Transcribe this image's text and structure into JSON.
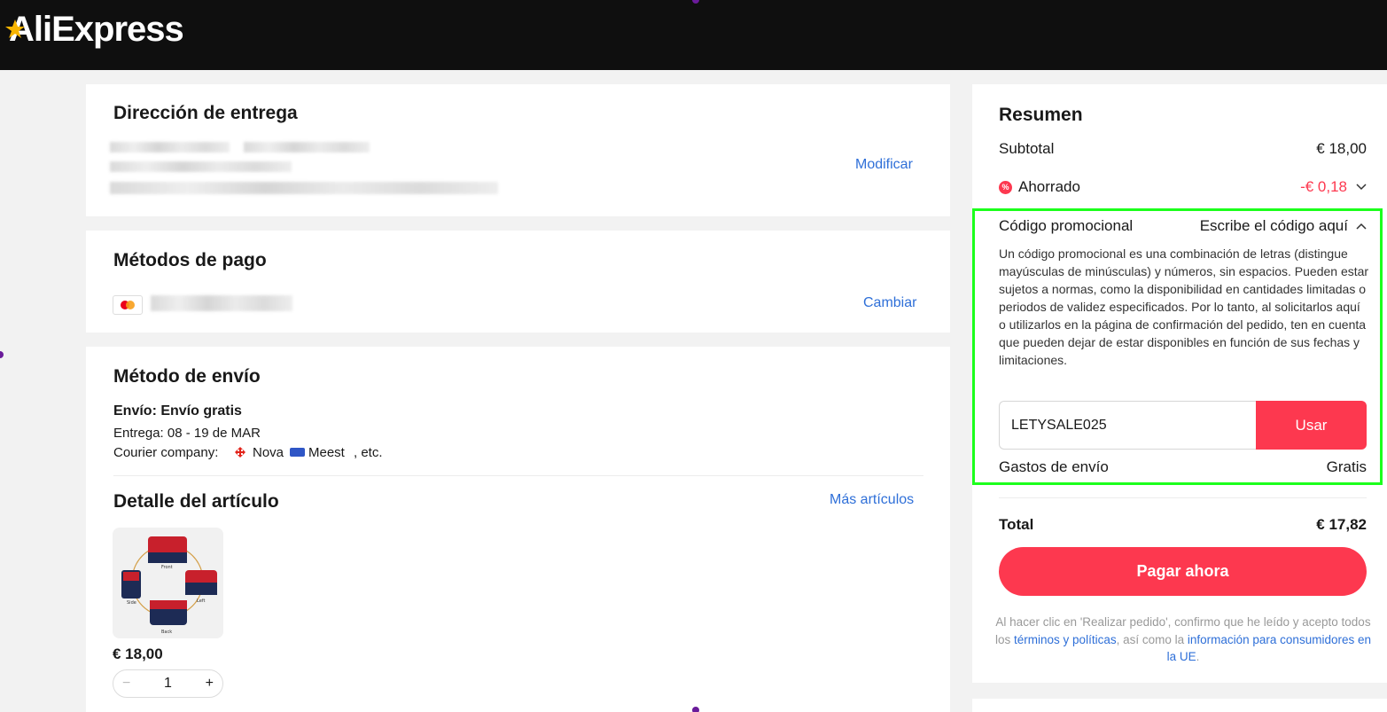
{
  "header": {
    "logo_text": "AliExpress"
  },
  "address": {
    "title": "Dirección de entrega",
    "action": "Modificar"
  },
  "payment": {
    "title": "Métodos de pago",
    "action": "Cambiar"
  },
  "shipping": {
    "title": "Método de envío",
    "method": "Envío: Envío gratis",
    "delivery": "Entrega: 08 - 19 de MAR",
    "courier_label": "Courier company:",
    "courier_1": "Nova",
    "courier_2": "Meest",
    "courier_suffix": ", etc."
  },
  "items": {
    "title": "Detalle del artículo",
    "more_link": "Más artículos",
    "price": "€ 18,00",
    "quantity": "1",
    "minus": "−",
    "plus": "+",
    "image_labels": {
      "front": "Front",
      "side": "Side",
      "left": "Left",
      "back": "Back"
    }
  },
  "summary": {
    "title": "Resumen",
    "subtotal_label": "Subtotal",
    "subtotal_value": "€ 18,00",
    "saved_label": "Ahorrado",
    "saved_value": "-€ 0,18",
    "promo_label": "Código promocional",
    "promo_action": "Escribe el código aquí",
    "promo_description": "Un código promocional es una combinación de letras (distingue mayúsculas de minúsculas) y números, sin espacios. Pueden estar sujetos a normas, como la disponibilidad en cantidades limitadas o periodos de validez especificados. Por lo tanto, al solicitarlos aquí o utilizarlos en la página de confirmación del pedido, ten en cuenta que pueden dejar de estar disponibles en función de sus fechas y limitaciones.",
    "promo_code_value": "LETYSALE025",
    "promo_apply": "Usar",
    "shipping_label": "Gastos de envío",
    "shipping_value": "Gratis",
    "total_label": "Total",
    "total_value": "€ 17,82",
    "pay_button": "Pagar ahora",
    "legal_prefix": "Al hacer clic en 'Realizar pedido', confirmo que he leído y acepto todos los",
    "legal_link1": "términos y políticas",
    "legal_middle": ", así como la",
    "legal_link2": "información para consumidores en la UE",
    "legal_end": "."
  },
  "colors": {
    "accent": "#fd384f",
    "link": "#2e6fd8",
    "highlight": "#1cff1c",
    "header_bg": "#0f0f0f"
  }
}
